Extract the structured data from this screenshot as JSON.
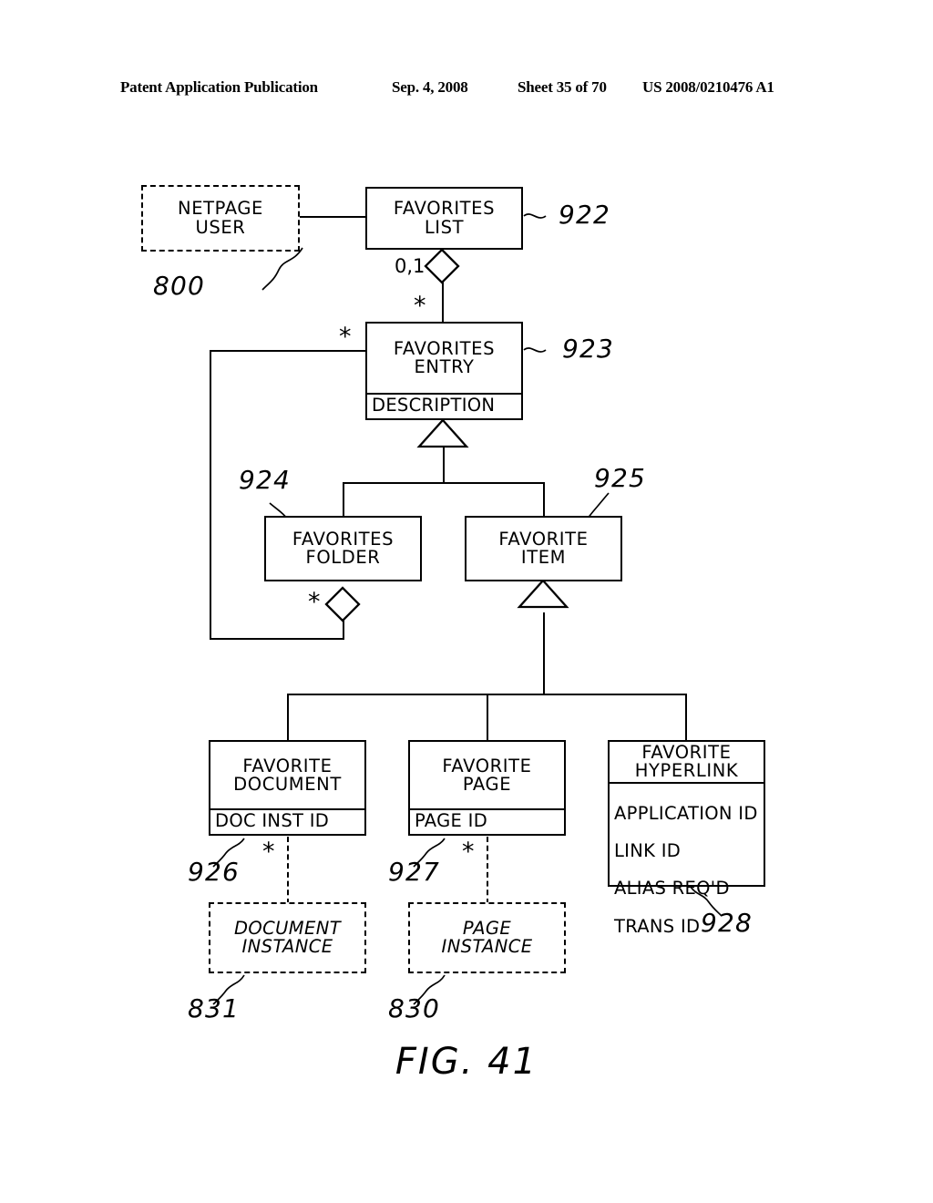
{
  "header": {
    "publication": "Patent Application Publication",
    "date": "Sep. 4, 2008",
    "sheet": "Sheet 35 of 70",
    "patent_number": "US 2008/0210476 A1"
  },
  "figure": {
    "caption": "FIG. 41"
  },
  "diagram": {
    "type": "uml-class-diagram",
    "classes": [
      {
        "id": "netpage-user",
        "name": "NETPAGE\nUSER",
        "ref": "800",
        "style": "dashed",
        "attributes": []
      },
      {
        "id": "favorites-list",
        "name": "FAVORITES\nLIST",
        "ref": "922",
        "style": "solid",
        "attributes": []
      },
      {
        "id": "favorites-entry",
        "name": "FAVORITES\nENTRY",
        "ref": "923",
        "style": "solid",
        "attributes": [
          "DESCRIPTION"
        ]
      },
      {
        "id": "favorites-folder",
        "name": "FAVORITES\nFOLDER",
        "ref": "924",
        "style": "solid",
        "attributes": []
      },
      {
        "id": "favorite-item",
        "name": "FAVORITE\nITEM",
        "ref": "925",
        "style": "solid",
        "attributes": []
      },
      {
        "id": "favorite-document",
        "name": "FAVORITE\nDOCUMENT",
        "ref": "926",
        "style": "solid",
        "attributes": [
          "DOC INST ID"
        ]
      },
      {
        "id": "favorite-page",
        "name": "FAVORITE\nPAGE",
        "ref": "927",
        "style": "solid",
        "attributes": [
          "PAGE ID"
        ]
      },
      {
        "id": "favorite-hyperlink",
        "name": "FAVORITE\nHYPERLINK",
        "ref": "928",
        "style": "solid",
        "attributes": [
          "APPLICATION ID",
          "LINK ID",
          "ALIAS REQ'D",
          "TRANS ID"
        ]
      },
      {
        "id": "document-instance",
        "name": "DOCUMENT\nINSTANCE",
        "ref": "831",
        "style": "dashed-italic",
        "attributes": []
      },
      {
        "id": "page-instance",
        "name": "PAGE\nINSTANCE",
        "ref": "830",
        "style": "dashed-italic",
        "attributes": []
      }
    ],
    "multiplicities": {
      "list_to_entry_aggregate": "0,1",
      "list_to_entry_many": "*",
      "entry_to_folder_many": "*",
      "folder_aggregate_many": "*",
      "favorite_document_many": "*",
      "favorite_page_many": "*"
    },
    "relations": [
      {
        "from": "netpage-user",
        "to": "favorites-list",
        "kind": "association"
      },
      {
        "from": "favorites-list",
        "to": "favorites-entry",
        "kind": "aggregation",
        "source_mult": "0,1",
        "target_mult": "*"
      },
      {
        "from": "favorites-entry",
        "to": "favorites-folder",
        "kind": "aggregation",
        "source_mult": "*",
        "target_mult": "*"
      },
      {
        "from": "favorites-entry",
        "to": "favorites-folder",
        "kind": "generalization"
      },
      {
        "from": "favorites-entry",
        "to": "favorite-item",
        "kind": "generalization"
      },
      {
        "from": "favorite-item",
        "to": "favorite-document",
        "kind": "generalization"
      },
      {
        "from": "favorite-item",
        "to": "favorite-page",
        "kind": "generalization"
      },
      {
        "from": "favorite-item",
        "to": "favorite-hyperlink",
        "kind": "generalization"
      },
      {
        "from": "favorite-document",
        "to": "document-instance",
        "kind": "dependency",
        "source_mult": "*"
      },
      {
        "from": "favorite-page",
        "to": "page-instance",
        "kind": "dependency",
        "source_mult": "*"
      }
    ]
  }
}
